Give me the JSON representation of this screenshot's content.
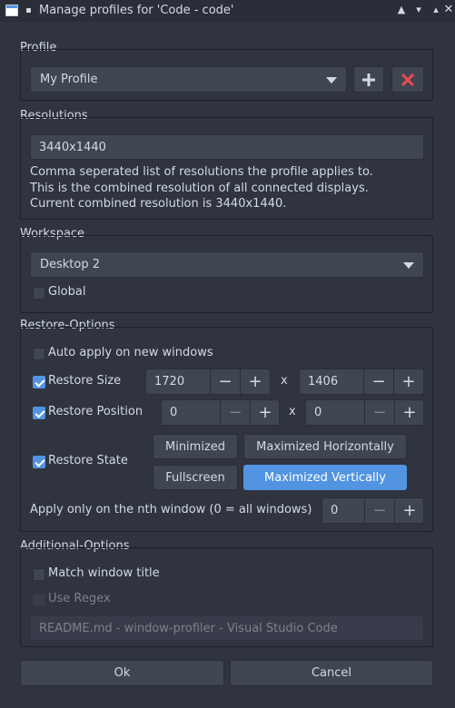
{
  "window": {
    "title": "Manage profiles for 'Code - code'"
  },
  "profile": {
    "group_label": "Profile",
    "selected": "My Profile",
    "add_icon": "plus-icon",
    "delete_icon": "delete-x-icon"
  },
  "resolutions": {
    "group_label": "Resolutions",
    "value": "3440x1440",
    "desc_line1": "Comma seperated list of resolutions the profile applies to.",
    "desc_line2": "This is the combined resolution of all connected displays.",
    "desc_line3": "Current combined resolution is 3440x1440."
  },
  "workspace": {
    "group_label": "Workspace",
    "selected": "Desktop 2",
    "global_label": "Global",
    "global_checked": false
  },
  "restore": {
    "group_label": "Restore-Options",
    "auto_apply_label": "Auto apply on new windows",
    "auto_apply_checked": false,
    "size_label": "Restore Size",
    "size_checked": true,
    "size_w": "1720",
    "size_h": "1406",
    "x_sep": "x",
    "position_label": "Restore Position",
    "position_checked": true,
    "pos_x": "0",
    "pos_y": "0",
    "state_label": "Restore State",
    "state_checked": true,
    "state_minimized": "Minimized",
    "state_max_h": "Maximized Horizontally",
    "state_fullscreen": "Fullscreen",
    "state_max_v": "Maximized Vertically",
    "state_max_v_active": true,
    "nth_label": "Apply only on the nth window (0 = all windows)",
    "nth_value": "0"
  },
  "additional": {
    "group_label": "Additional-Options",
    "match_title_label": "Match window title",
    "match_title_checked": false,
    "regex_label": "Use Regex",
    "regex_checked": false,
    "title_value": "README.md - window-profiler - Visual Studio Code"
  },
  "footer": {
    "ok_label": "Ok",
    "cancel_label": "Cancel"
  },
  "colors": {
    "accent": "#5294e2",
    "window_bg": "#2f343f",
    "delete_red": "#f04a50"
  }
}
